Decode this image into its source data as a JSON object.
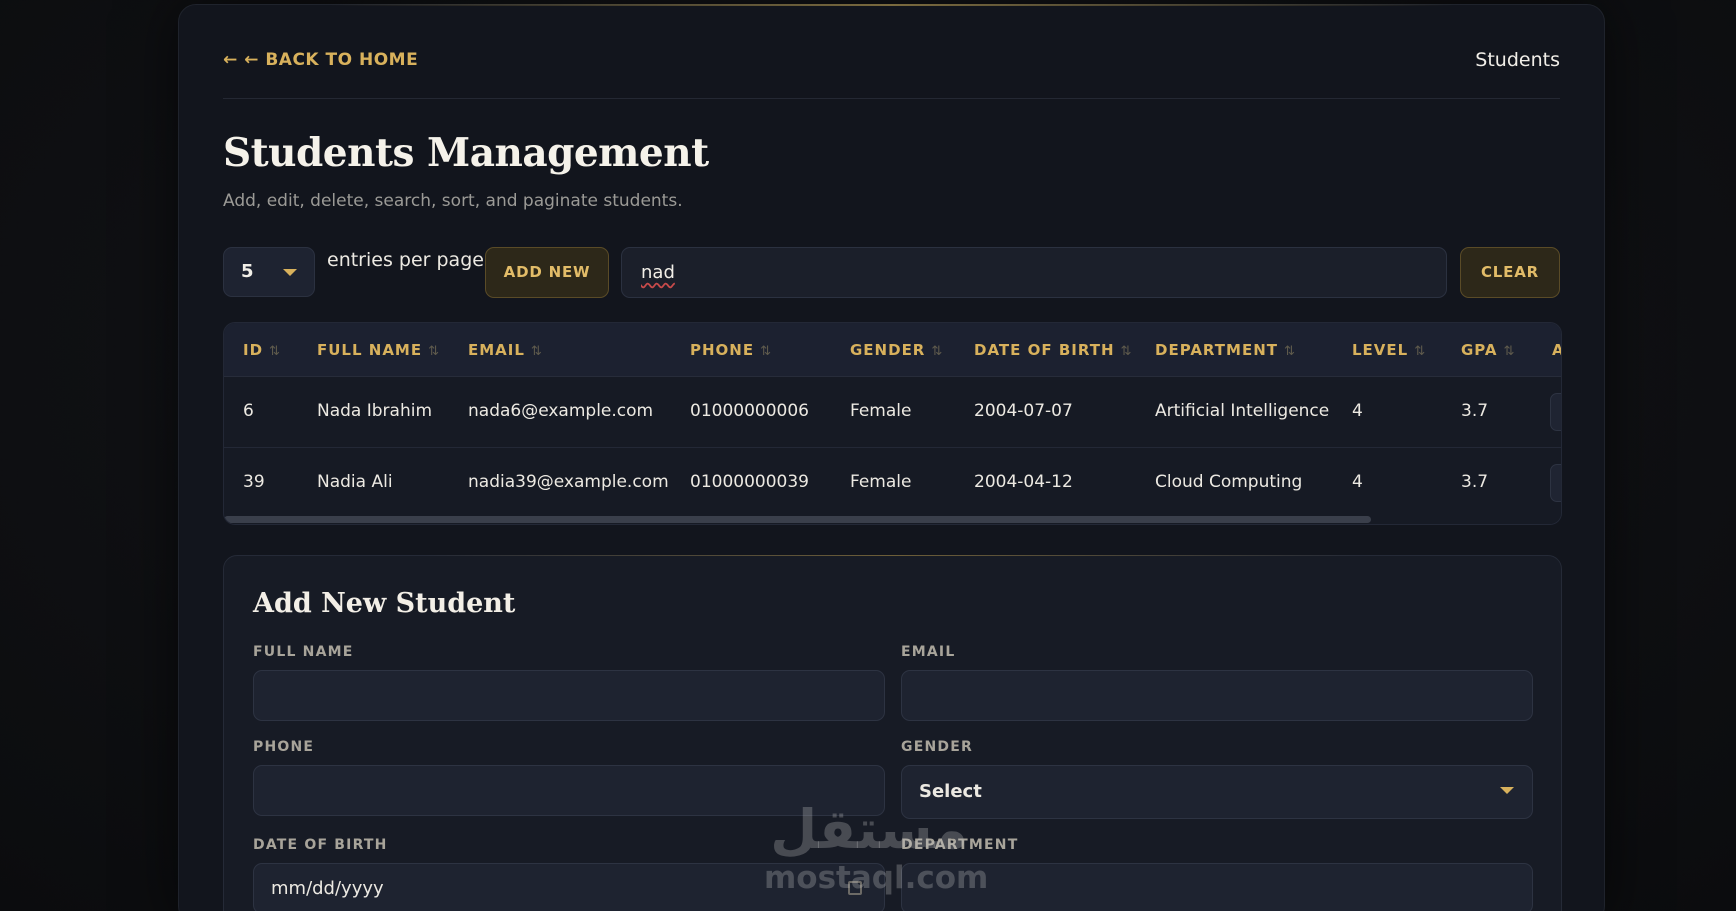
{
  "nav": {
    "back_label": "← ← BACK TO HOME",
    "current": "Students"
  },
  "header": {
    "title": "Students Management",
    "subtitle": "Add, edit, delete, search, sort, and paginate students."
  },
  "controls": {
    "entries_value": "5",
    "entries_label": "entries per page",
    "add_new_label": "ADD NEW",
    "search_value": "nad",
    "clear_label": "CLEAR"
  },
  "table": {
    "columns": [
      "ID",
      "FULL NAME",
      "EMAIL",
      "PHONE",
      "GENDER",
      "DATE OF BIRTH",
      "DEPARTMENT",
      "LEVEL",
      "GPA",
      "A"
    ],
    "sort_glyph": "⇅",
    "rows": [
      [
        "6",
        "Nada Ibrahim",
        "nada6@example.com",
        "01000000006",
        "Female",
        "2004-07-07",
        "Artificial Intelligence",
        "4",
        "3.7"
      ],
      [
        "39",
        "Nadia Ali",
        "nadia39@example.com",
        "01000000039",
        "Female",
        "2004-04-12",
        "Cloud Computing",
        "4",
        "3.7"
      ]
    ]
  },
  "form": {
    "title": "Add New Student",
    "full_name_label": "FULL NAME",
    "email_label": "EMAIL",
    "phone_label": "PHONE",
    "gender_label": "GENDER",
    "gender_value": "Select",
    "dob_label": "DATE OF BIRTH",
    "dob_placeholder": "mm/dd/yyyy",
    "department_label": "DEPARTMENT"
  },
  "watermark": {
    "arabic": "مستقل",
    "latin": "mostaql.com"
  },
  "colors": {
    "accent": "#d8b15c",
    "background": "#12151d"
  }
}
